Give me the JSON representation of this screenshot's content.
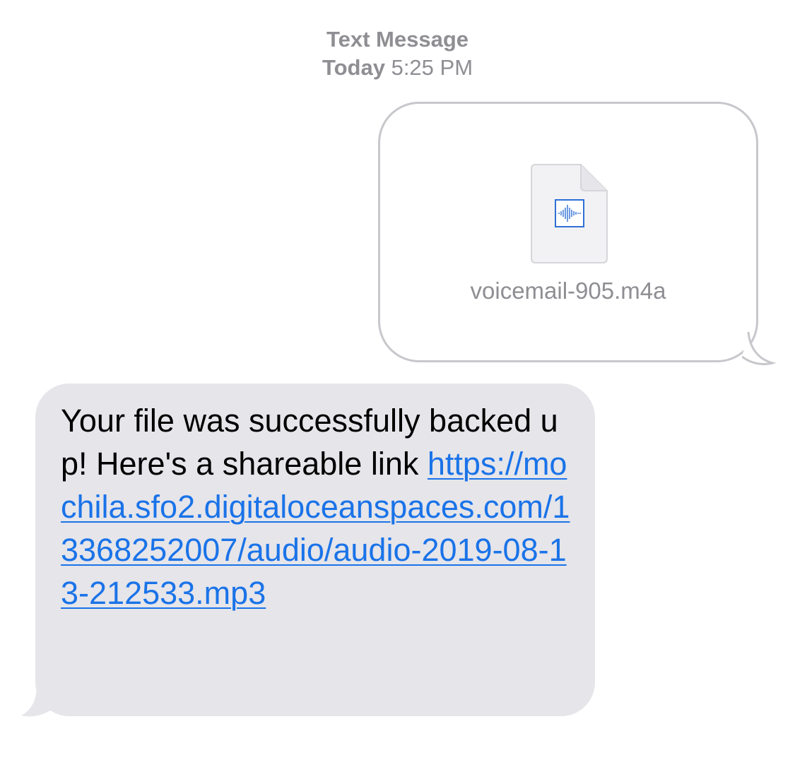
{
  "header": {
    "service": "Text Message",
    "day": "Today",
    "time": "5:25 PM"
  },
  "outgoing": {
    "attachment_icon": "audio-file-icon",
    "file_name": "voicemail-905.m4a"
  },
  "incoming": {
    "text": "Your file was successfully backed up! Here's a shareable link ",
    "link": "https://mochila.sfo2.digitaloceanspaces.com/13368252007/audio/audio-2019-08-13-212533.mp3"
  },
  "colors": {
    "incoming_bubble": "#e5e5ea",
    "outgoing_border": "#c7c7cc",
    "link": "#1a73e8",
    "meta_text": "#8e8e93",
    "waveform": "#2f6fd6"
  }
}
